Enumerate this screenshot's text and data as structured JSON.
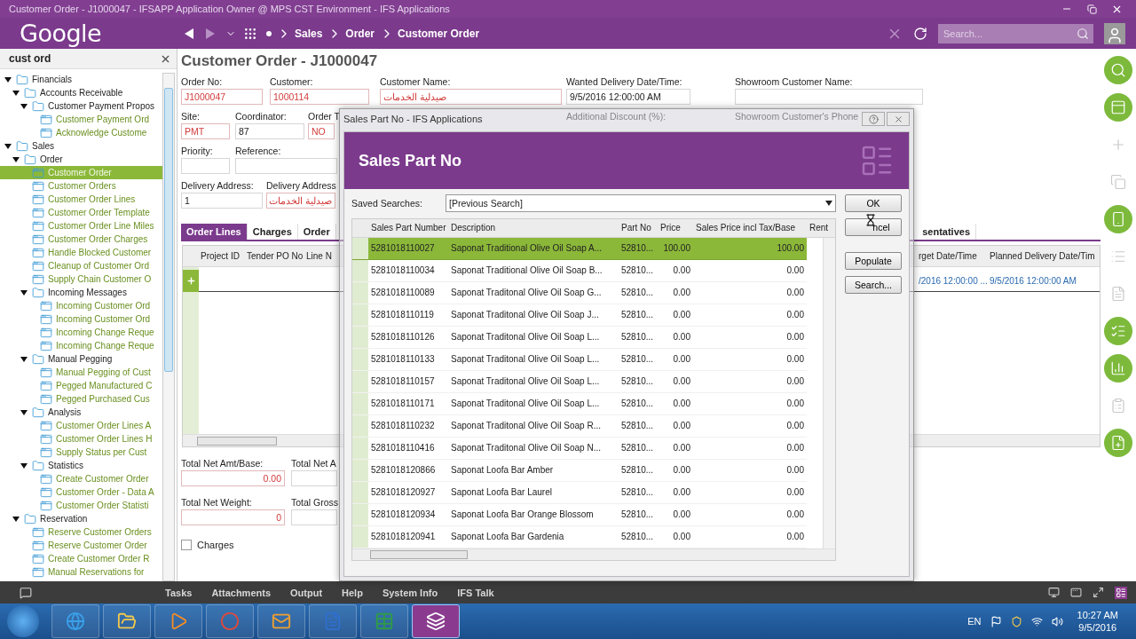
{
  "window": {
    "title": "Customer Order - J1000047 - IFSAPP Application Owner @ MPS CST Environment - IFS Applications"
  },
  "nav": {
    "logo": "Google",
    "breadcrumbs": [
      "Sales",
      "Order",
      "Customer Order"
    ],
    "search": {
      "placeholder": "Search..."
    }
  },
  "sidebar": {
    "search": "cust ord",
    "tree": [
      {
        "label": "Financials",
        "kind": "folder",
        "expanded": true,
        "selected": false,
        "children": [
          {
            "label": "Accounts Receivable",
            "kind": "folder",
            "expanded": true,
            "selected": false,
            "children": [
              {
                "label": "Customer Payment Propos",
                "kind": "folder",
                "expanded": true,
                "selected": false,
                "children": [
                  {
                    "label": "Customer Payment Ord",
                    "kind": "screen",
                    "selected": false
                  },
                  {
                    "label": "Acknowledge Custome",
                    "kind": "screen",
                    "selected": false
                  }
                ]
              }
            ]
          }
        ]
      },
      {
        "label": "Sales",
        "kind": "folder",
        "expanded": true,
        "selected": false,
        "children": [
          {
            "label": "Order",
            "kind": "folder",
            "expanded": true,
            "selected": false,
            "children": [
              {
                "label": "Customer Order",
                "kind": "screen",
                "selected": true
              },
              {
                "label": "Customer Orders",
                "kind": "screen",
                "selected": false
              },
              {
                "label": "Customer Order Lines",
                "kind": "screen",
                "selected": false
              },
              {
                "label": "Customer Order Template",
                "kind": "screen",
                "selected": false
              },
              {
                "label": "Customer Order Line Miles",
                "kind": "screen",
                "selected": false
              },
              {
                "label": "Customer Order Charges",
                "kind": "screen",
                "selected": false
              },
              {
                "label": "Handle Blocked Customer",
                "kind": "screen",
                "selected": false
              },
              {
                "label": "Cleanup of Customer Ord",
                "kind": "screen",
                "selected": false
              },
              {
                "label": "Supply Chain Customer O",
                "kind": "screen",
                "selected": false
              },
              {
                "label": "Incoming Messages",
                "kind": "folder",
                "expanded": true,
                "selected": false,
                "children": [
                  {
                    "label": "Incoming Customer Ord",
                    "kind": "screen",
                    "selected": false
                  },
                  {
                    "label": "Incoming Customer Ord",
                    "kind": "screen",
                    "selected": false
                  },
                  {
                    "label": "Incoming Change Reque",
                    "kind": "screen",
                    "selected": false
                  },
                  {
                    "label": "Incoming Change Reque",
                    "kind": "screen",
                    "selected": false
                  }
                ]
              },
              {
                "label": "Manual Pegging",
                "kind": "folder",
                "expanded": true,
                "selected": false,
                "children": [
                  {
                    "label": "Manual Pegging of Cust",
                    "kind": "screen",
                    "selected": false
                  },
                  {
                    "label": "Pegged Manufactured C",
                    "kind": "screen",
                    "selected": false
                  },
                  {
                    "label": "Pegged Purchased Cus",
                    "kind": "screen",
                    "selected": false
                  }
                ]
              },
              {
                "label": "Analysis",
                "kind": "folder",
                "expanded": true,
                "selected": false,
                "children": [
                  {
                    "label": "Customer Order Lines A",
                    "kind": "screen",
                    "selected": false
                  },
                  {
                    "label": "Customer Order Lines H",
                    "kind": "screen",
                    "selected": false
                  },
                  {
                    "label": "Supply Status per Cust",
                    "kind": "screen",
                    "selected": false
                  }
                ]
              },
              {
                "label": "Statistics",
                "kind": "folder",
                "expanded": true,
                "selected": false,
                "children": [
                  {
                    "label": "Create Customer Order",
                    "kind": "screen",
                    "selected": false
                  },
                  {
                    "label": "Customer Order - Data A",
                    "kind": "screen",
                    "selected": false
                  },
                  {
                    "label": "Customer Order Statisti",
                    "kind": "screen",
                    "selected": false
                  }
                ]
              }
            ]
          },
          {
            "label": "Reservation",
            "kind": "folder",
            "expanded": true,
            "selected": false,
            "children": [
              {
                "label": "Reserve Customer Orders",
                "kind": "screen",
                "selected": false
              },
              {
                "label": "Reserve Customer Order",
                "kind": "screen",
                "selected": false
              },
              {
                "label": "Create Customer Order R",
                "kind": "screen",
                "selected": false
              },
              {
                "label": "Manual Reservations for",
                "kind": "screen",
                "selected": false
              }
            ]
          }
        ]
      }
    ]
  },
  "page": {
    "title": "Customer Order - J1000047",
    "field_rows": [
      [
        {
          "label": "Order No:",
          "kind": "input",
          "value": "J1000047",
          "required": true
        },
        {
          "label": "Customer:",
          "kind": "input",
          "value": "1000114",
          "required": true
        },
        {
          "label": "Customer Name:",
          "kind": "input",
          "value": "صيدلية الخدمات",
          "required": true
        },
        {
          "label": "Wanted Delivery Date/Time:",
          "kind": "input",
          "value": "9/5/2016 12:00:00 AM",
          "required": false
        },
        {
          "label": "Showroom Customer Name:",
          "kind": "input",
          "required": false
        }
      ],
      [
        {
          "label": "Site:",
          "kind": "input",
          "value": "PMT",
          "required": true
        },
        {
          "label": "Coordinator:",
          "kind": "input",
          "value": "87",
          "required": false
        },
        {
          "label": "Order T",
          "kind": "input",
          "value": "NO",
          "required": true
        },
        {
          "label": "Additional Discount (%):",
          "kind": "label"
        },
        {
          "label": "Showroom Customer's Phone",
          "kind": "label"
        }
      ],
      [
        {
          "label": "Priority:",
          "kind": "input",
          "required": false
        },
        {
          "label": "Reference:",
          "kind": "input",
          "required": false
        }
      ],
      [
        {
          "label": "Delivery Address:",
          "kind": "input",
          "value": "1",
          "required": false
        },
        {
          "label": "Delivery Address",
          "kind": "input",
          "value": "صيدلية الخدمات",
          "required": true
        }
      ]
    ],
    "tabs": [
      {
        "label": "Order Lines",
        "selected": true
      },
      {
        "label": "Charges",
        "selected": false
      },
      {
        "label": "Order",
        "selected": false
      }
    ],
    "tabs_right": [
      {
        "label": "sentatives",
        "selected": false
      }
    ],
    "grid": {
      "columns": [
        "Project ID",
        "Tender PO No",
        "Line N"
      ],
      "columns_right": [
        "rget Date/Time",
        "Planned Delivery Date/Tim"
      ],
      "row_cells_right": [
        "/2016 12:00:00 ...",
        "9/5/2016 12:00:00 AM"
      ]
    },
    "totals": [
      [
        {
          "label": "Total Net Amt/Base:",
          "kind": "input",
          "value": "0.00",
          "required": true
        },
        {
          "label": "Total Net A",
          "kind": "input",
          "required": false
        }
      ],
      [
        {
          "label": "Total Net Weight:",
          "kind": "input",
          "value": "0",
          "required": true
        },
        {
          "label": "Total Gross",
          "kind": "input",
          "required": false
        }
      ]
    ],
    "charges": {
      "label": "Charges",
      "checked": false
    }
  },
  "dialog": {
    "window_title": "Sales Part No - IFS Applications",
    "heading": "Sales Part No",
    "saved_searches": {
      "label": "Saved Searches:",
      "value": "[Previous Search]"
    },
    "buttons": [
      "OK",
      "ncel",
      "Populate",
      "Search..."
    ],
    "columns": [
      "Sales Part Number",
      "Description",
      "Part No",
      "Price",
      "Sales Price incl Tax/Base",
      "Rent"
    ],
    "rows": [
      {
        "selected": true,
        "cells": [
          "5281018110027",
          "Saponat Traditional Olive Oil Soap A...",
          "52810...",
          "100.00",
          "100.00"
        ]
      },
      {
        "selected": false,
        "cells": [
          "5281018110034",
          "Saponat Traditional Olive Oil Soap B...",
          "52810...",
          "0.00",
          "0.00"
        ]
      },
      {
        "selected": false,
        "cells": [
          "5281018110089",
          "Saponat Traditonal Olive Oil Soap G...",
          "52810...",
          "0.00",
          "0.00"
        ]
      },
      {
        "selected": false,
        "cells": [
          "5281018110119",
          "Saponat Traditonal Olive Oil Soap J...",
          "52810...",
          "0.00",
          "0.00"
        ]
      },
      {
        "selected": false,
        "cells": [
          "5281018110126",
          "Saponat Traditonal Olive Oil Soap L...",
          "52810...",
          "0.00",
          "0.00"
        ]
      },
      {
        "selected": false,
        "cells": [
          "5281018110133",
          "Saponat Traditonal Olive Oil Soap L...",
          "52810...",
          "0.00",
          "0.00"
        ]
      },
      {
        "selected": false,
        "cells": [
          "5281018110157",
          "Saponat Traditonal Olive Oil Soap L...",
          "52810...",
          "0.00",
          "0.00"
        ]
      },
      {
        "selected": false,
        "cells": [
          "5281018110171",
          "Saponat Traditonal Olive Oil Soap L...",
          "52810...",
          "0.00",
          "0.00"
        ]
      },
      {
        "selected": false,
        "cells": [
          "5281018110232",
          "Saponat Traditonal Olive Oil Soap R...",
          "52810...",
          "0.00",
          "0.00"
        ]
      },
      {
        "selected": false,
        "cells": [
          "5281018110416",
          "Saponat Traditonal Olive Oil Soap N...",
          "52810...",
          "0.00",
          "0.00"
        ]
      },
      {
        "selected": false,
        "cells": [
          "5281018120866",
          "Saponat Loofa Bar Amber",
          "52810...",
          "0.00",
          "0.00"
        ]
      },
      {
        "selected": false,
        "cells": [
          "5281018120927",
          "Saponat Loofa Bar Laurel",
          "52810...",
          "0.00",
          "0.00"
        ]
      },
      {
        "selected": false,
        "cells": [
          "5281018120934",
          "Saponat Loofa Bar Orange Blossom",
          "52810...",
          "0.00",
          "0.00"
        ]
      },
      {
        "selected": false,
        "cells": [
          "5281018120941",
          "Saponat Loofa Bar Gardenia",
          "52810...",
          "0.00",
          "0.00"
        ]
      }
    ]
  },
  "rail": [
    {
      "disabled": false
    },
    {
      "disabled": false
    },
    {
      "disabled": true
    },
    {
      "disabled": true
    },
    {
      "disabled": false
    },
    {
      "disabled": true
    },
    {
      "disabled": true
    },
    {
      "disabled": false
    },
    {
      "disabled": false
    },
    {
      "disabled": true
    },
    {
      "disabled": false
    }
  ],
  "toolbar": {
    "links": [
      "Tasks",
      "Attachments",
      "Output",
      "Help",
      "System Info",
      "IFS Talk"
    ]
  },
  "taskbar": {
    "apps": [
      {
        "selected": false
      },
      {
        "selected": false
      },
      {
        "selected": false
      },
      {
        "selected": false
      },
      {
        "selected": false
      },
      {
        "selected": false
      },
      {
        "selected": false
      },
      {
        "selected": true
      }
    ],
    "language": "EN",
    "time": "10:27 AM",
    "date": "9/5/2016"
  }
}
